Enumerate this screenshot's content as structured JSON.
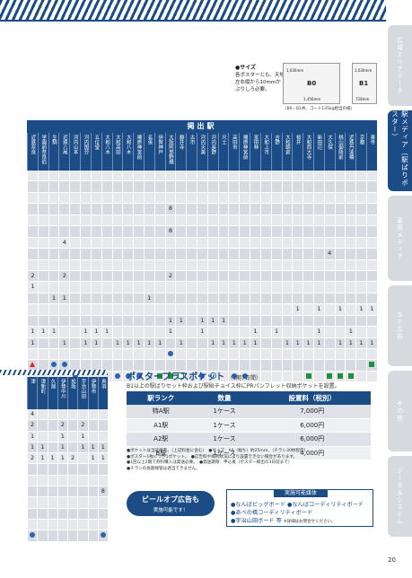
{
  "side_tabs": [
    {
      "label": "広域エリアデータ",
      "active": false
    },
    {
      "label": "駅メディア（駅ばりポスター）",
      "active": true
    },
    {
      "label": "車両メディア",
      "active": false
    },
    {
      "label": "ＳＰ広告",
      "active": false
    },
    {
      "label": "その他",
      "active": false
    },
    {
      "label": "データ＆システム",
      "active": false
    }
  ],
  "sizes": {
    "title": "●サイズ",
    "note": "各ポスターとも、天地左右縦から10mmかぶりしろ必要。",
    "b0_label": "B0",
    "b0_h": "1,030mm",
    "b0_w": "1,456mm",
    "b1_label": "B1",
    "b1_h": "1,030mm",
    "b1_w": "728mm",
    "caption": "（B0・B1共、コート135kg相当の紙）"
  },
  "main_table": {
    "header": "掲出駅",
    "columns": [
      "近鉄奈良",
      "学園前奈良伯",
      "生駒",
      "近鉄八尾",
      "河内山本",
      "河内国分",
      "五位堂",
      "大和八木",
      "大和高田",
      "大和八木",
      "橿原神宮前",
      "名張",
      "伊賀神戸",
      "大阪阿部野橋",
      "藤井寺",
      "古市",
      "河内天美",
      "河内長野",
      "尺土",
      "高田市",
      "橿原神宮前",
      "富田林",
      "大和上市",
      "吉野",
      "大和朝倉",
      "桜井",
      "大和西大寺",
      "新田辺",
      "大久保",
      "桃山御陵前",
      "近鉄丹波橋",
      "京都",
      "東寺"
    ],
    "rows": [
      [
        "",
        "",
        "",
        "",
        "",
        "",
        "",
        "",
        "",
        "",
        "",
        "",
        "",
        "",
        "",
        "",
        "",
        "",
        "",
        "",
        "",
        "",
        "",
        "",
        "",
        "",
        "",
        "",
        "",
        "",
        "",
        "",
        ""
      ],
      [
        "",
        "",
        "",
        "",
        "",
        "",
        "",
        "",
        "",
        "",
        "",
        "",
        "",
        "",
        "",
        "",
        "",
        "",
        "",
        "",
        "",
        "",
        "",
        "",
        "",
        "",
        "",
        "",
        "",
        "",
        "",
        "",
        ""
      ],
      [
        "",
        "",
        "",
        "",
        "",
        "",
        "",
        "",
        "",
        "",
        "",
        "",
        "",
        "",
        "",
        "",
        "",
        "",
        "",
        "",
        "",
        "",
        "",
        "",
        "",
        "",
        "",
        "",
        "",
        "",
        "",
        "",
        ""
      ],
      [
        "",
        "",
        "",
        "",
        "",
        "",
        "",
        "",
        "",
        "",
        "",
        "",
        "",
        "8",
        "",
        "",
        "",
        "",
        "",
        "",
        "",
        "",
        "",
        "",
        "",
        "",
        "",
        "",
        "",
        "",
        "",
        "",
        ""
      ],
      [
        "",
        "",
        "",
        "",
        "",
        "",
        "",
        "",
        "",
        "",
        "",
        "",
        "",
        "",
        "",
        "",
        "",
        "",
        "",
        "",
        "",
        "",
        "",
        "",
        "",
        "",
        "",
        "",
        "",
        "",
        "",
        "",
        ""
      ],
      [
        "",
        "",
        "",
        "",
        "",
        "",
        "",
        "",
        "",
        "",
        "",
        "",
        "",
        "8",
        "",
        "",
        "",
        "",
        "",
        "",
        "",
        "",
        "",
        "",
        "",
        "",
        "",
        "",
        "",
        "",
        "",
        "",
        ""
      ],
      [
        "",
        "",
        "",
        "4",
        "",
        "",
        "",
        "",
        "",
        "",
        "",
        "",
        "",
        "",
        "",
        "",
        "",
        "",
        "",
        "",
        "",
        "",
        "",
        "",
        "",
        "",
        "",
        "",
        "",
        "",
        "",
        "",
        ""
      ],
      [
        "",
        "",
        "",
        "",
        "",
        "",
        "",
        "",
        "",
        "",
        "",
        "",
        "",
        "",
        "",
        "",
        "",
        "",
        "",
        "",
        "",
        "",
        "",
        "",
        "",
        "",
        "",
        "",
        "4",
        "",
        "",
        "",
        ""
      ],
      [
        "",
        "",
        "",
        "",
        "",
        "",
        "",
        "",
        "",
        "",
        "",
        "",
        "",
        "",
        "",
        "",
        "",
        "",
        "",
        "",
        "",
        "",
        "",
        "",
        "",
        "",
        "",
        "",
        "",
        "",
        "",
        "",
        ""
      ],
      [
        "2",
        "",
        "",
        "2",
        "",
        "",
        "",
        "",
        "",
        "",
        "",
        "",
        "",
        "2",
        "",
        "",
        "",
        "",
        "",
        "",
        "",
        "",
        "",
        "",
        "",
        "",
        "",
        "",
        "",
        "",
        "",
        "",
        ""
      ],
      [
        "1",
        "",
        "",
        "",
        "",
        "",
        "",
        "",
        "",
        "",
        "",
        "",
        "",
        "",
        "",
        "",
        "",
        "",
        "",
        "",
        "",
        "",
        "",
        "",
        "",
        "",
        "",
        "",
        "",
        "",
        "",
        "",
        ""
      ],
      [
        "",
        "",
        "1",
        "1",
        "",
        "",
        "",
        "",
        "",
        "",
        "",
        "1",
        "",
        "",
        "",
        "",
        "",
        "",
        "",
        "",
        "",
        "",
        "",
        "",
        "",
        "",
        "",
        "",
        "",
        "",
        "",
        "",
        ""
      ],
      [
        "",
        "",
        "",
        "",
        "",
        "",
        "",
        "",
        "",
        "",
        "",
        "",
        "",
        "",
        "",
        "",
        "",
        "",
        "",
        "",
        "",
        "",
        "",
        "",
        "",
        "1",
        "",
        "1",
        "",
        "1",
        "",
        "1",
        "1"
      ],
      [
        "",
        "",
        "",
        "",
        "",
        "",
        "",
        "",
        "",
        "",
        "",
        "",
        "",
        "1",
        "1",
        "",
        "1",
        "1",
        "1",
        "",
        "",
        "",
        "",
        "",
        "",
        "",
        "",
        "",
        "",
        "",
        "",
        "",
        ""
      ],
      [
        "1",
        "1",
        "1",
        "",
        "",
        "1",
        "1",
        "1",
        "",
        "",
        "",
        "",
        "",
        "1",
        "",
        "",
        "1",
        "",
        "",
        "",
        "",
        "1",
        "",
        "1",
        "",
        "",
        "",
        "1",
        "",
        "",
        "1",
        "",
        ""
      ],
      [
        "1",
        "",
        "",
        "1",
        "",
        "1",
        "1",
        "",
        "1",
        "1",
        "1",
        "1",
        "1",
        "",
        "1",
        "",
        "",
        "1",
        "1",
        "1",
        "1",
        "1",
        "",
        "",
        "1",
        "1",
        "1",
        "1",
        "",
        "1",
        "1",
        "1",
        "1"
      ],
      [
        "",
        "",
        "",
        "",
        "",
        "",
        "",
        "",
        "",
        "",
        "",
        "",
        "",
        "dot",
        "",
        "",
        "",
        "",
        "",
        "",
        "",
        "",
        "",
        "",
        "",
        "",
        "",
        "",
        "",
        "",
        "",
        "",
        ""
      ],
      [
        "tri",
        "",
        "dot",
        "dot",
        "",
        "",
        "",
        "",
        "",
        "",
        "",
        "",
        "",
        "",
        "",
        "",
        "",
        "",
        "",
        "",
        "",
        "",
        "",
        "",
        "",
        "",
        "",
        "",
        "",
        "",
        "",
        "",
        "sq"
      ],
      [
        "",
        "",
        "",
        "",
        "dot",
        "",
        "",
        "",
        "dot",
        "dot",
        "dot",
        "",
        "sq",
        "sq",
        "sqo",
        "",
        "dot",
        "cir",
        "",
        "dot",
        "dot",
        "",
        "",
        "",
        "",
        "",
        "sq",
        "",
        "sq",
        "sq",
        "sq",
        "",
        ""
      ]
    ]
  },
  "bottom_left_table": {
    "columns": [
      "津",
      "津新町",
      "久居",
      "伊勢中川",
      "松阪",
      "宇治山田",
      "伊勢市",
      "鳥羽"
    ],
    "rows": [
      [
        "4",
        "",
        "",
        "",
        "",
        "",
        "",
        ""
      ],
      [
        "2",
        "",
        "",
        "2",
        "",
        "2",
        "",
        ""
      ],
      [
        "1",
        "",
        "",
        "1",
        "",
        "1",
        "",
        ""
      ],
      [
        "1",
        "1",
        "",
        "1",
        "",
        "1",
        "1",
        "1"
      ],
      [
        "2",
        "1",
        "1",
        "1",
        "2",
        "",
        "1",
        "1"
      ],
      [
        "",
        "",
        "",
        "",
        "",
        "",
        "",
        ""
      ],
      [
        "",
        "",
        "",
        "",
        "",
        "",
        "",
        ""
      ],
      [
        "",
        "",
        "",
        "",
        "",
        "",
        "",
        "8"
      ],
      [
        "",
        "",
        "",
        "",
        "",
        "",
        "",
        ""
      ],
      [
        "",
        "",
        "",
        "",
        "",
        "",
        "",
        ""
      ],
      [
        "",
        "",
        "",
        "",
        "",
        "",
        "",
        ""
      ],
      [
        "dot",
        "",
        "",
        "",
        "",
        "",
        "",
        "dot"
      ]
    ]
  },
  "poster_plus": {
    "title": "ポスタープラスポケット",
    "period": "（1期7日間）",
    "desc": "B1以上の駅ばりセット枠および駅貼チョイス枠にPRパンフレット収納ポケットを設置。",
    "headers": [
      "駅ランク",
      "数量",
      "設置料（税別）"
    ],
    "rows": [
      [
        "特A駅",
        "1ケース",
        "7,000円"
      ],
      [
        "A1駅",
        "1ケース",
        "6,000円"
      ],
      [
        "A2駅",
        "1ケース",
        "6,000円"
      ],
      [
        "B駅",
        "1ケース",
        "4,000円"
      ]
    ],
    "notes": [
      "●ポケットは当社所有。（上記料金に含む）　●サイズ：A4（幅ち）約25mm、（チラシ30枚程度）",
      "●ポスター1枚につき1ポケット。　●広告料や場所状況により設置できない場合があります。",
      "●1回以上2期で券料購入は発送必要。　●発送期限：申込後（ポスター掲出の3日前まで）",
      "●チラシの長期保管は適当できません。"
    ]
  },
  "beer_ad": {
    "line1": "ビールオプ広告も",
    "line2": "実施可能です！"
  },
  "available": {
    "header": "実施可能媒体",
    "items": [
      "●なんばビッグボード ●なんばコーディリティボード",
      "●あべの橋コーディリティボード",
      "●宇治山田ボード 等"
    ],
    "note": "※詳細はお問合せください。"
  },
  "page_number": "20"
}
